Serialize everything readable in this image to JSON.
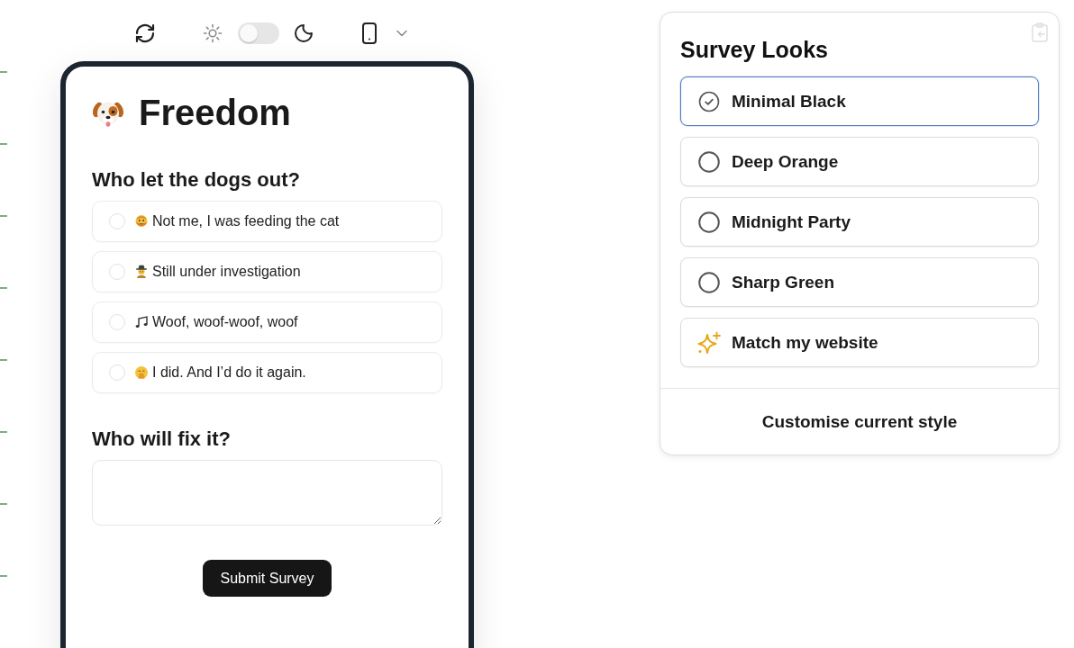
{
  "toolbar": {
    "dark_mode": {
      "on": false
    }
  },
  "preview": {
    "title": "Freedom",
    "questions": [
      {
        "kind": "choice",
        "title": "Who let the dogs out?",
        "options": [
          {
            "label": "Not me, I was feeding the cat",
            "selected": false
          },
          {
            "label": "Still under investigation",
            "selected": false
          },
          {
            "label": "Woof, woof-woof, woof",
            "selected": false
          },
          {
            "label": "I did. And I’d do it again.",
            "selected": false
          }
        ]
      },
      {
        "kind": "text",
        "title": "Who will fix it?"
      }
    ],
    "submit": "Submit Survey"
  },
  "looks_panel": {
    "title": "Survey Looks",
    "styles": [
      {
        "kind": "theme",
        "label": "Minimal Black",
        "selected": true
      },
      {
        "kind": "theme",
        "label": "Deep Orange",
        "selected": false
      },
      {
        "kind": "theme",
        "label": "Midnight Party",
        "selected": false
      },
      {
        "kind": "theme",
        "label": "Sharp Green",
        "selected": false
      },
      {
        "kind": "auto",
        "label": "Match my website",
        "selected": false
      }
    ],
    "customise": "Customise current style"
  }
}
